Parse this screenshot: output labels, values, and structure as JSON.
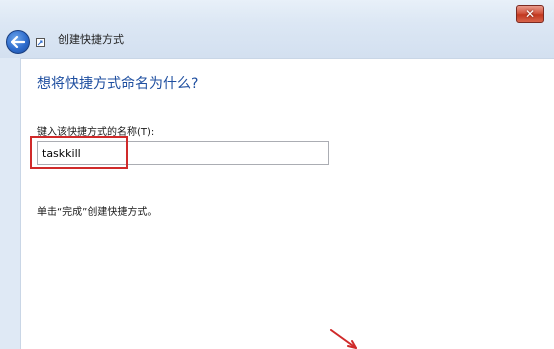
{
  "window": {
    "close_glyph": "✕",
    "wizard_title": "创建快捷方式",
    "back_icon": "back-arrow-icon"
  },
  "page": {
    "heading": "想将快捷方式命名为什么?",
    "field_label": "键入该快捷方式的名称(T):",
    "input_value": "taskkill",
    "hint": "单击“完成”创建快捷方式。"
  },
  "colors": {
    "heading": "#1f4fa0",
    "highlight": "#d02a2a",
    "close_button": "#c2381f",
    "back_button": "#2e6ccd"
  }
}
